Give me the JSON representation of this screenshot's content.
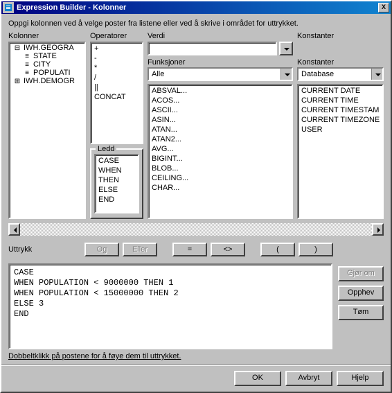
{
  "window": {
    "title": "Expression Builder - Kolonner",
    "close": "X"
  },
  "instructions": {
    "line1": "Oppgi kolonnen ved å velge poster fra listene eller ved å skrive i området for uttrykket.",
    "line2": "Dobbeltklikk på postene for å føye dem til uttrykket."
  },
  "labels": {
    "kolonner": "Kolonner",
    "operatorer": "Operatorer",
    "verdi": "Verdi",
    "funksjoner": "Funksjoner",
    "konstanter": "Konstanter",
    "alle": "Alle",
    "database": "Database",
    "ledd": "Ledd",
    "uttrykk": "Uttrykk"
  },
  "buttons": {
    "og": "Og",
    "eller": "Eller",
    "eq": "=",
    "neq": "<>",
    "lpar": "(",
    "rpar": ")",
    "gjor_om": "Gjør om",
    "opphev": "Opphev",
    "tom": "Tøm",
    "ok": "OK",
    "avbryt": "Avbryt",
    "hjelp": "Hjelp"
  },
  "tree": [
    {
      "indent": 0,
      "icon": "⊟",
      "label": "IWH.GEOGRA"
    },
    {
      "indent": 1,
      "icon": "≡",
      "label": "STATE"
    },
    {
      "indent": 1,
      "icon": "≡",
      "label": "CITY"
    },
    {
      "indent": 1,
      "icon": "≡",
      "label": "POPULATI"
    },
    {
      "indent": 0,
      "icon": "⊞",
      "label": "IWH.DEMOGR"
    }
  ],
  "operators": [
    "+",
    "-",
    "*",
    "/",
    "||",
    "CONCAT"
  ],
  "ledd": [
    "CASE",
    "WHEN",
    "THEN",
    "ELSE",
    "END"
  ],
  "functions": [
    "ABSVAL...",
    "ACOS...",
    "ASCII...",
    "ASIN...",
    "ATAN...",
    "ATAN2...",
    "AVG...",
    "BIGINT...",
    "BLOB...",
    "CEILING...",
    "CHAR..."
  ],
  "constants": [
    "CURRENT DATE",
    "CURRENT TIME",
    "CURRENT TIMESTAM",
    "CURRENT TIMEZONE",
    "USER"
  ],
  "verdi_value": "",
  "expression": "CASE\nWHEN POPULATION < 9000000 THEN 1\nWHEN POPULATION < 15000000 THEN 2\nELSE 3\nEND"
}
